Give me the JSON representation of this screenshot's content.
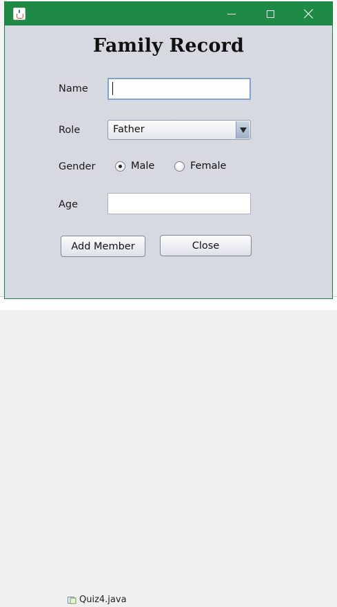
{
  "background": {
    "ide_file_name": "Quiz4.java"
  },
  "window": {
    "title": "",
    "titlebar_color": "#1e8a45",
    "controls": {
      "minimize_icon": "minimize-icon",
      "maximize_icon": "maximize-icon",
      "close_icon": "close-icon"
    }
  },
  "form": {
    "heading": "Family Record",
    "name": {
      "label": "Name",
      "value": "",
      "placeholder": ""
    },
    "role": {
      "label": "Role",
      "selected": "Father"
    },
    "gender": {
      "label": "Gender",
      "options": [
        {
          "label": "Male",
          "selected": true
        },
        {
          "label": "Female",
          "selected": false
        }
      ]
    },
    "age": {
      "label": "Age",
      "value": "",
      "placeholder": ""
    },
    "buttons": {
      "add_member": "Add Member",
      "close": "Close"
    }
  }
}
